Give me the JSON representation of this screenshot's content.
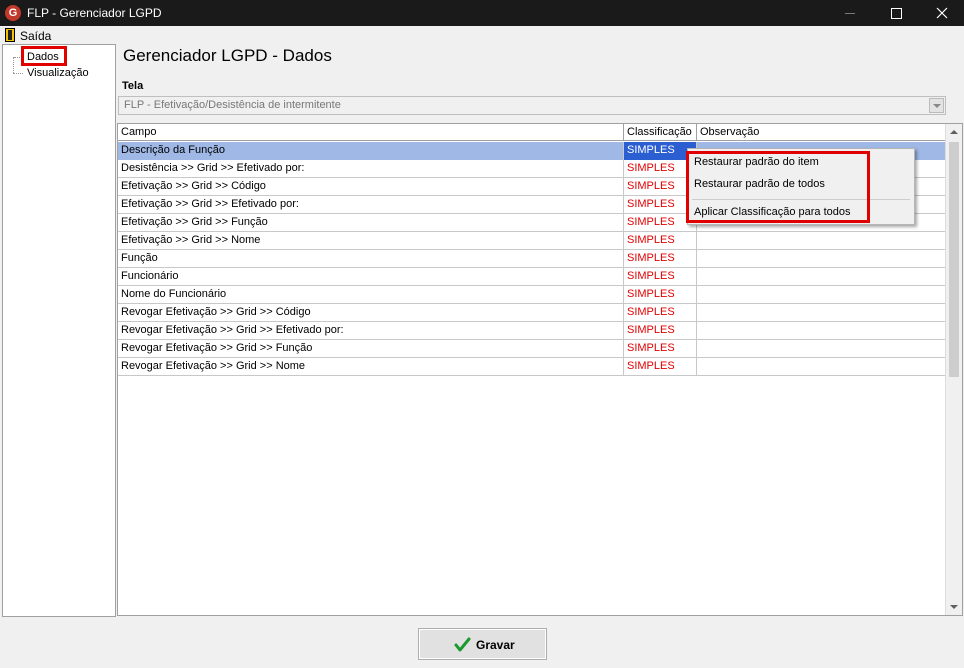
{
  "window": {
    "title": "FLP - Gerenciador LGPD"
  },
  "menu": {
    "exit_label": "Saída"
  },
  "tree": {
    "items": [
      {
        "label": "Dados"
      },
      {
        "label": "Visualização"
      }
    ]
  },
  "page": {
    "title": "Gerenciador LGPD - Dados"
  },
  "screen_field": {
    "label": "Tela",
    "value": "FLP - Efetivação/Desistência de intermitente"
  },
  "grid": {
    "columns": [
      "Campo",
      "Classificação",
      "Observação"
    ],
    "rows": [
      {
        "campo": "Descrição da Função",
        "classificacao": "SIMPLES",
        "observacao": ""
      },
      {
        "campo": "Desistência >> Grid >> Efetivado por:",
        "classificacao": "SIMPLES",
        "observacao": ""
      },
      {
        "campo": "Efetivação >> Grid >> Código",
        "classificacao": "SIMPLES",
        "observacao": ""
      },
      {
        "campo": "Efetivação >> Grid >> Efetivado por:",
        "classificacao": "SIMPLES",
        "observacao": ""
      },
      {
        "campo": "Efetivação >> Grid >> Função",
        "classificacao": "SIMPLES",
        "observacao": ""
      },
      {
        "campo": "Efetivação >> Grid >> Nome",
        "classificacao": "SIMPLES",
        "observacao": ""
      },
      {
        "campo": "Função",
        "classificacao": "SIMPLES",
        "observacao": ""
      },
      {
        "campo": "Funcionário",
        "classificacao": "SIMPLES",
        "observacao": ""
      },
      {
        "campo": "Nome do Funcionário",
        "classificacao": "SIMPLES",
        "observacao": ""
      },
      {
        "campo": "Revogar Efetivação >> Grid >> Código",
        "classificacao": "SIMPLES",
        "observacao": ""
      },
      {
        "campo": "Revogar Efetivação >> Grid >> Efetivado por:",
        "classificacao": "SIMPLES",
        "observacao": ""
      },
      {
        "campo": "Revogar Efetivação >> Grid >> Função",
        "classificacao": "SIMPLES",
        "observacao": ""
      },
      {
        "campo": "Revogar Efetivação >> Grid >> Nome",
        "classificacao": "SIMPLES",
        "observacao": ""
      }
    ]
  },
  "context_menu": {
    "items": [
      "Restaurar padrão do item",
      "Restaurar padrão de todos",
      "Aplicar Classificação para todos"
    ]
  },
  "save_button": {
    "label": "Gravar"
  },
  "colors": {
    "highlight": "#e00000",
    "selection": "#2b5fd1",
    "classification_text": "#e00000"
  }
}
